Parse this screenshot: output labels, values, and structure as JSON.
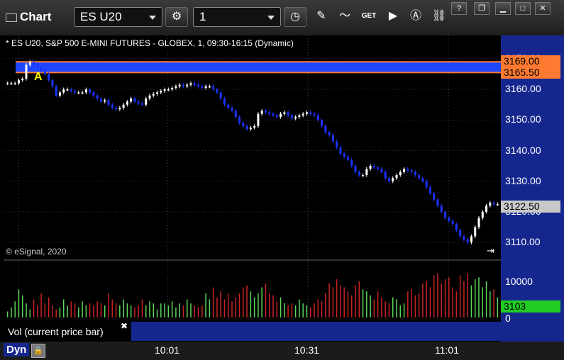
{
  "toolbar": {
    "title": "Chart",
    "symbol": "ES U20",
    "interval": "1",
    "get_label": "GET"
  },
  "chart_header": "* ES U20, S&P 500 E-MINI FUTURES - GLOBEX, 1, 09:30-16:15 (Dynamic)",
  "copyright": "© eSignal, 2020",
  "annotation_letter": "A",
  "price_axis": {
    "ticks": [
      "3170.00",
      "3160.00",
      "3150.00",
      "3140.00",
      "3130.00",
      "3120.00",
      "3110.00"
    ],
    "upper_band": "3169.00",
    "lower_band": "3165.50",
    "last_price": "3122.50"
  },
  "volume_axis": {
    "ticks": [
      "10000",
      "0"
    ],
    "current_volume": "3103"
  },
  "volume_legend": "Vol (current price bar)",
  "dyn_label": "Dyn",
  "time_axis": [
    "10:01",
    "10:31",
    "11:01"
  ],
  "colors": {
    "up": "#ffffff",
    "down": "#1a33ff",
    "band": "#1f46ff",
    "band_line": "#ff7a30",
    "vol_up": "#5ad85a",
    "vol_down": "#cc2222",
    "last_price_bg": "#c8c8c8",
    "volume_tag_bg": "#22cc22"
  },
  "chart_data": {
    "type": "candlestick",
    "ylim": [
      3107,
      3173
    ],
    "series": [
      {
        "name": "price",
        "values": [
          3162,
          3162,
          3162,
          3163,
          3163.5,
          3168,
          3169,
          3168,
          3167,
          3166,
          3165,
          3163,
          3161,
          3158,
          3159,
          3160,
          3160,
          3159.5,
          3159,
          3159,
          3159,
          3160,
          3159,
          3158,
          3157,
          3156,
          3156.5,
          3155,
          3154,
          3153.5,
          3154,
          3155,
          3156,
          3157,
          3156,
          3155.5,
          3155,
          3157,
          3158,
          3158.5,
          3159,
          3159.5,
          3160,
          3160,
          3160.5,
          3161,
          3161.5,
          3161,
          3161.5,
          3162,
          3161.5,
          3161,
          3160.5,
          3161,
          3161,
          3160,
          3159,
          3157,
          3155,
          3154,
          3153,
          3151,
          3149,
          3148,
          3147,
          3147.5,
          3148,
          3152,
          3153,
          3152.5,
          3152,
          3151.5,
          3151,
          3152,
          3152.5,
          3151.5,
          3150.5,
          3151,
          3151.5,
          3152,
          3152.5,
          3152,
          3151.5,
          3150,
          3148,
          3146,
          3145,
          3143,
          3141,
          3139,
          3138,
          3137,
          3135,
          3133,
          3132,
          3132,
          3134,
          3135,
          3134.5,
          3134,
          3133,
          3131,
          3130,
          3131,
          3132,
          3133,
          3134,
          3133.5,
          3133,
          3132,
          3131,
          3130,
          3128,
          3126,
          3124,
          3122,
          3120,
          3118,
          3117,
          3116,
          3114,
          3112,
          3111,
          3110,
          3112,
          3115,
          3118,
          3120,
          3122,
          3123,
          3122.5,
          3122.5
        ]
      },
      {
        "name": "volume",
        "values": [
          1500,
          2500,
          4000,
          7000,
          5500,
          3500,
          2000,
          4500,
          3000,
          6000,
          3500,
          5000,
          3000,
          2000,
          2500,
          4500,
          3000,
          4000,
          3500,
          2500,
          4000,
          3000,
          3500,
          3000,
          4000,
          3500,
          3000,
          6000,
          4500,
          3500,
          3000,
          4500,
          3500,
          3000,
          2500,
          3000,
          4500,
          3000,
          4000,
          3500,
          2000,
          3500,
          3500,
          3000,
          4000,
          2500,
          3500,
          3000,
          4500,
          3500,
          3000,
          2500,
          3000,
          6000,
          4500,
          7500,
          5000,
          6500,
          4500,
          6000,
          4000,
          5000,
          6000,
          7500,
          8000,
          6500,
          5000,
          6000,
          7500,
          8500,
          6000,
          5500,
          4000,
          5000,
          3500,
          3000,
          3500,
          3000,
          4500,
          3500,
          3000,
          2500,
          3500,
          4500,
          4000,
          6000,
          8500,
          7500,
          9500,
          8000,
          7500,
          6500,
          5500,
          8000,
          9000,
          7000,
          6500,
          5500,
          4500,
          6500,
          5000,
          4000,
          3500,
          5000,
          4500,
          3000,
          3500,
          6500,
          7000,
          5500,
          6000,
          8500,
          9000,
          7500,
          10500,
          11000,
          8500,
          9500,
          10000,
          7500,
          6500,
          10500,
          9000,
          11000,
          8000,
          9500,
          10000,
          7500,
          9000,
          6500,
          7000,
          5000,
          3103
        ]
      }
    ]
  }
}
